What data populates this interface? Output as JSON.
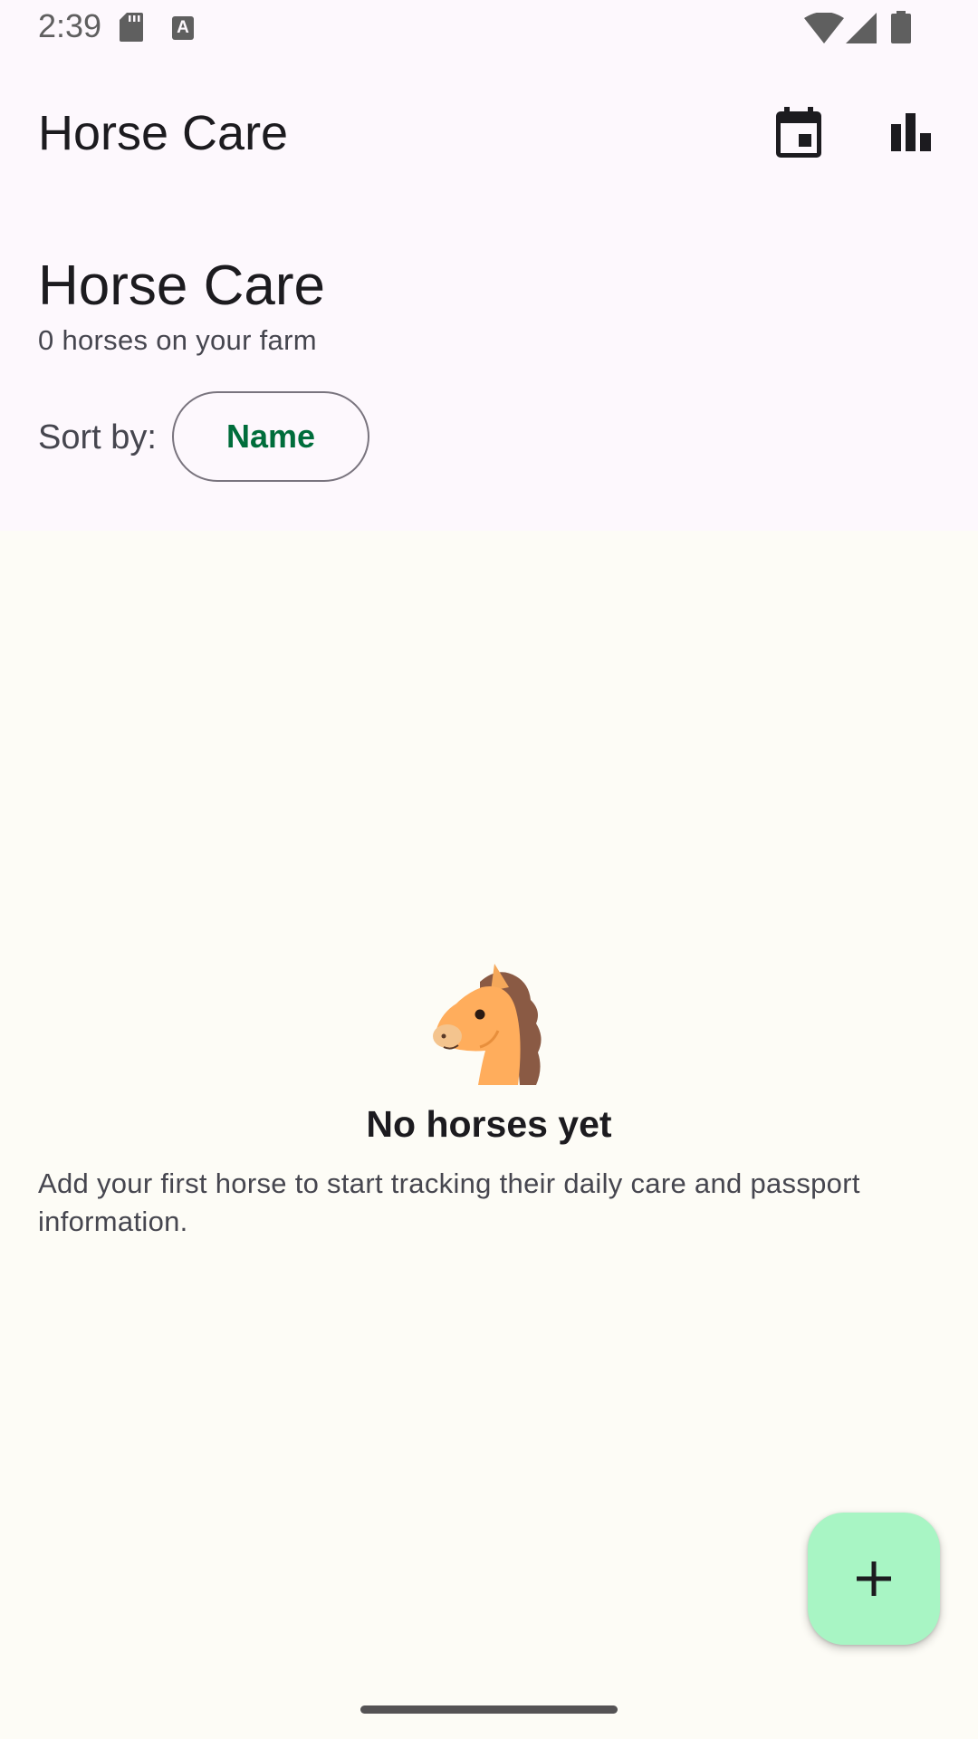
{
  "status_bar": {
    "time": "2:39",
    "a_icon_letter": "A",
    "icons": [
      "sd-card-icon",
      "a-notification-icon",
      "wifi-icon",
      "signal-icon",
      "battery-icon"
    ]
  },
  "app_bar": {
    "title": "Horse Care",
    "actions": [
      "calendar-icon",
      "bar-chart-icon"
    ]
  },
  "header": {
    "title": "Horse Care",
    "subtitle": "0 horses on your farm",
    "sort_label": "Sort by:",
    "sort_value": "Name"
  },
  "empty_state": {
    "icon": "horse-face-icon",
    "title": "No horses yet",
    "description": "Add your first horse to start tracking their daily care and passport information."
  },
  "fab": {
    "icon": "plus-icon"
  },
  "colors": {
    "background": "#fdf8fd",
    "content_background": "#fdfcf6",
    "accent": "#006d3b",
    "fab": "#a8f5c4",
    "outline": "#79747e"
  }
}
